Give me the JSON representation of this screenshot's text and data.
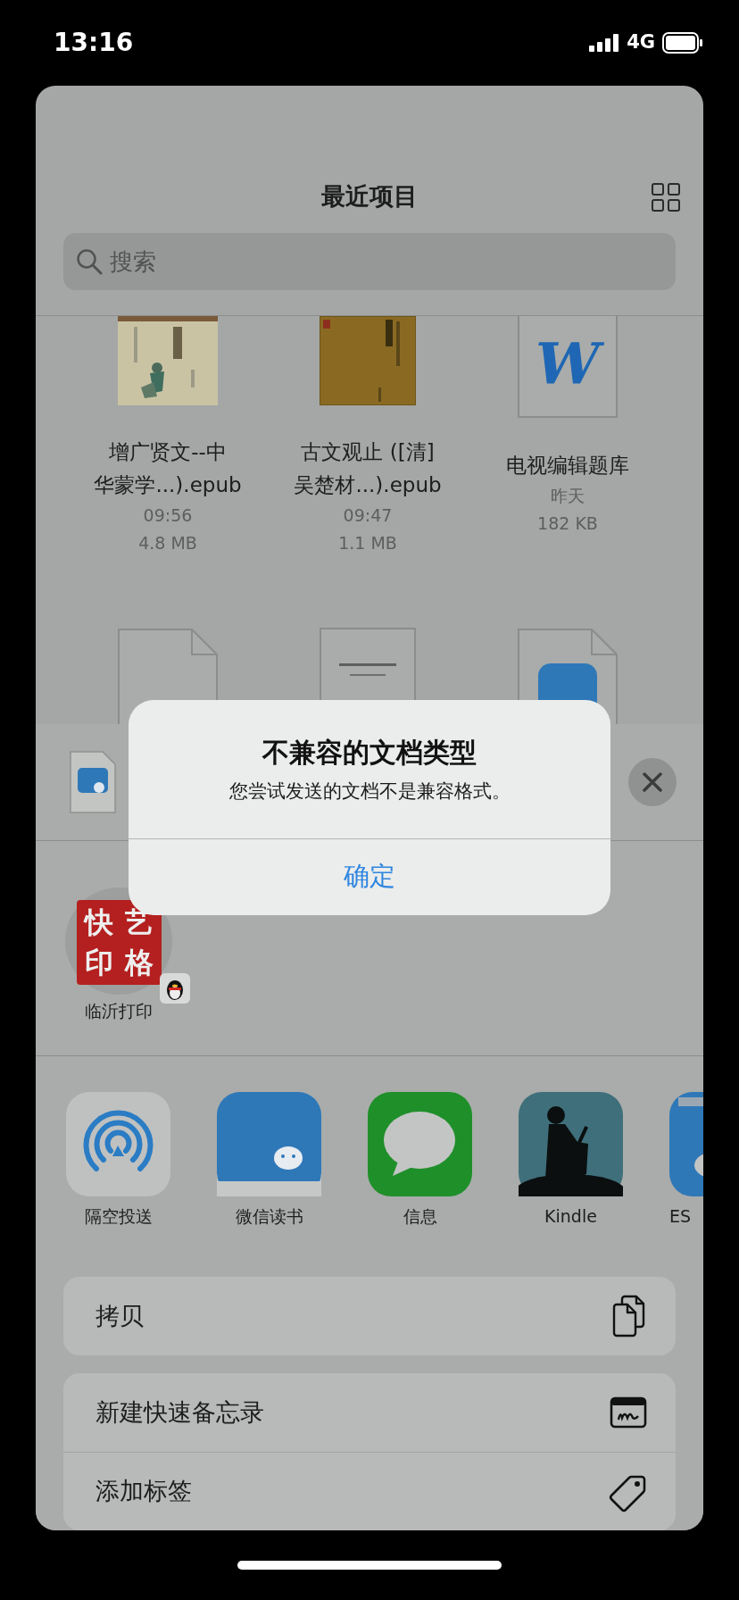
{
  "status_bar": {
    "time": "13:16",
    "network": "4G"
  },
  "browser": {
    "title": "最近项目",
    "search": {
      "placeholder": "搜索"
    },
    "files": [
      {
        "kind": "cover",
        "name_lines": [
          "增广贤文--中",
          "华蒙学...).epub"
        ],
        "date": "09:56",
        "size": "4.8 MB"
      },
      {
        "kind": "cover",
        "name_lines": [
          "古文观止 ([清]",
          "吴楚材...).epub"
        ],
        "date": "09:47",
        "size": "1.1 MB"
      },
      {
        "kind": "word",
        "letter": "W",
        "name_lines": [
          "电视编辑题库"
        ],
        "date": "昨天",
        "size": "182 KB"
      },
      {
        "kind": "word"
      },
      {
        "kind": "page"
      },
      {
        "kind": "wechat-doc"
      }
    ]
  },
  "share": {
    "print_targets": [
      {
        "label": "临沂打印",
        "logo_chars": [
          "快",
          "艺",
          "印",
          "格"
        ]
      }
    ],
    "apps": [
      {
        "kind": "airdrop",
        "label": "隔空投送"
      },
      {
        "kind": "wechat-read",
        "label": "微信读书"
      },
      {
        "kind": "messages",
        "label": "信息"
      },
      {
        "kind": "kindle",
        "label": "Kindle"
      },
      {
        "kind": "es",
        "label": "ES"
      }
    ],
    "action_groups": [
      [
        {
          "kind": "copy",
          "label": "拷贝"
        }
      ],
      [
        {
          "kind": "note",
          "label": "新建快速备忘录"
        },
        {
          "kind": "tag",
          "label": "添加标签"
        }
      ]
    ]
  },
  "alert": {
    "title": "不兼容的文档类型",
    "message": "您尝试发送的文档不是兼容格式。",
    "button": "确定"
  }
}
